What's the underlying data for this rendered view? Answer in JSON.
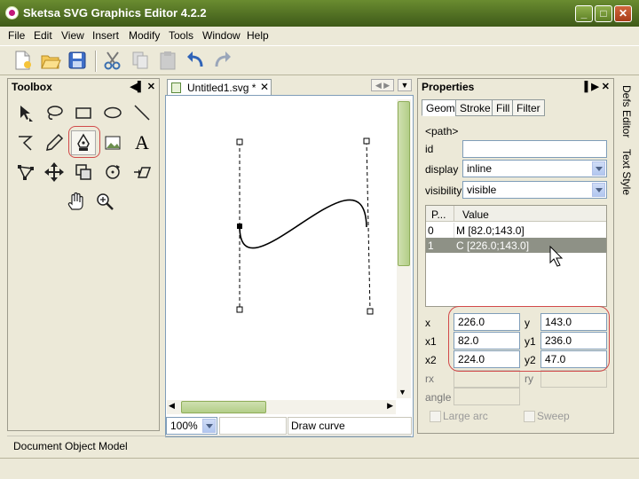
{
  "window": {
    "title": "Sketsa SVG Graphics Editor 4.2.2",
    "min": "_",
    "max": "□",
    "close": "✕"
  },
  "menu": [
    "File",
    "Edit",
    "View",
    "Insert",
    "Modify",
    "Tools",
    "Window",
    "Help"
  ],
  "toolbar": [
    "new-file-icon",
    "open-folder-icon",
    "save-icon",
    "cut-icon",
    "copy-icon",
    "paste-icon",
    "undo-icon",
    "redo-icon"
  ],
  "toolbox": {
    "title": "Toolbox",
    "tools": [
      "select-arrow",
      "lasso",
      "rectangle",
      "ellipse",
      "line",
      "polyline",
      "pencil",
      "pen",
      "image",
      "text",
      "node-edit",
      "move",
      "transform",
      "rotate",
      "skew",
      "hand",
      "zoom"
    ],
    "active_tool": "pen"
  },
  "document": {
    "tab": "Untitled1.svg *",
    "zoom": "100%",
    "status": "Draw curve"
  },
  "properties": {
    "title": "Properties",
    "tabs": [
      "Geom",
      "Stroke",
      "Fill",
      "Filter"
    ],
    "active_tab": "Geom",
    "element": "<path>",
    "id_label": "id",
    "id_value": "",
    "display_label": "display",
    "display_value": "inline",
    "visibility_label": "visibility",
    "visibility_value": "visible",
    "table_headers": [
      "P...",
      "Value"
    ],
    "rows": [
      {
        "p": "0",
        "value": "M [82.0;143.0]"
      },
      {
        "p": "1",
        "value": "C [226.0;143.0]"
      }
    ],
    "selected_row": 1,
    "fields": {
      "x": {
        "label": "x",
        "value": "226.0"
      },
      "y": {
        "label": "y",
        "value": "143.0"
      },
      "x1": {
        "label": "x1",
        "value": "82.0"
      },
      "y1": {
        "label": "y1",
        "value": "236.0"
      },
      "x2": {
        "label": "x2",
        "value": "224.0"
      },
      "y2": {
        "label": "y2",
        "value": "47.0"
      },
      "rx": {
        "label": "rx",
        "value": ""
      },
      "ry": {
        "label": "ry",
        "value": ""
      },
      "angle": {
        "label": "angle",
        "value": ""
      }
    },
    "large_arc": "Large arc",
    "sweep": "Sweep"
  },
  "side_tabs": [
    "Defs Editor",
    "Text Style"
  ],
  "bottom_panel": "Document Object Model",
  "colors": {
    "titlebar": "#5b7a26",
    "highlight": "#d24a4a",
    "selected_row": "#8e9186"
  }
}
